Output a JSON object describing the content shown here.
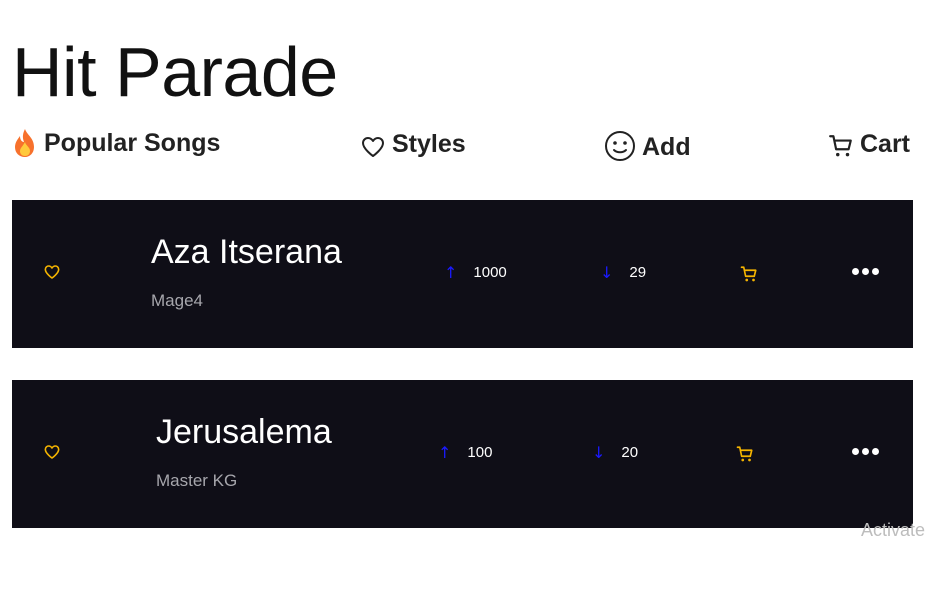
{
  "page": {
    "title": "Hit Parade"
  },
  "nav": {
    "popular": {
      "label": "Popular Songs",
      "icon": "fire-icon"
    },
    "styles": {
      "label": "Styles",
      "icon": "heart-icon"
    },
    "add": {
      "label": "Add",
      "icon": "smile-icon"
    },
    "cart": {
      "label": "Cart",
      "icon": "cart-icon"
    }
  },
  "songs": [
    {
      "title": "Aza Itserana",
      "artist": "Mage4",
      "upvotes": "1000",
      "downvotes": "29"
    },
    {
      "title": "Jerusalema",
      "artist": "Master KG",
      "upvotes": "100",
      "downvotes": "20"
    }
  ],
  "watermark": "Activate",
  "colors": {
    "card_bg": "#0f0e17",
    "accent_yellow": "#f5b400",
    "arrow_blue": "#1a1aff",
    "artist_gray": "#a6a6ac"
  }
}
